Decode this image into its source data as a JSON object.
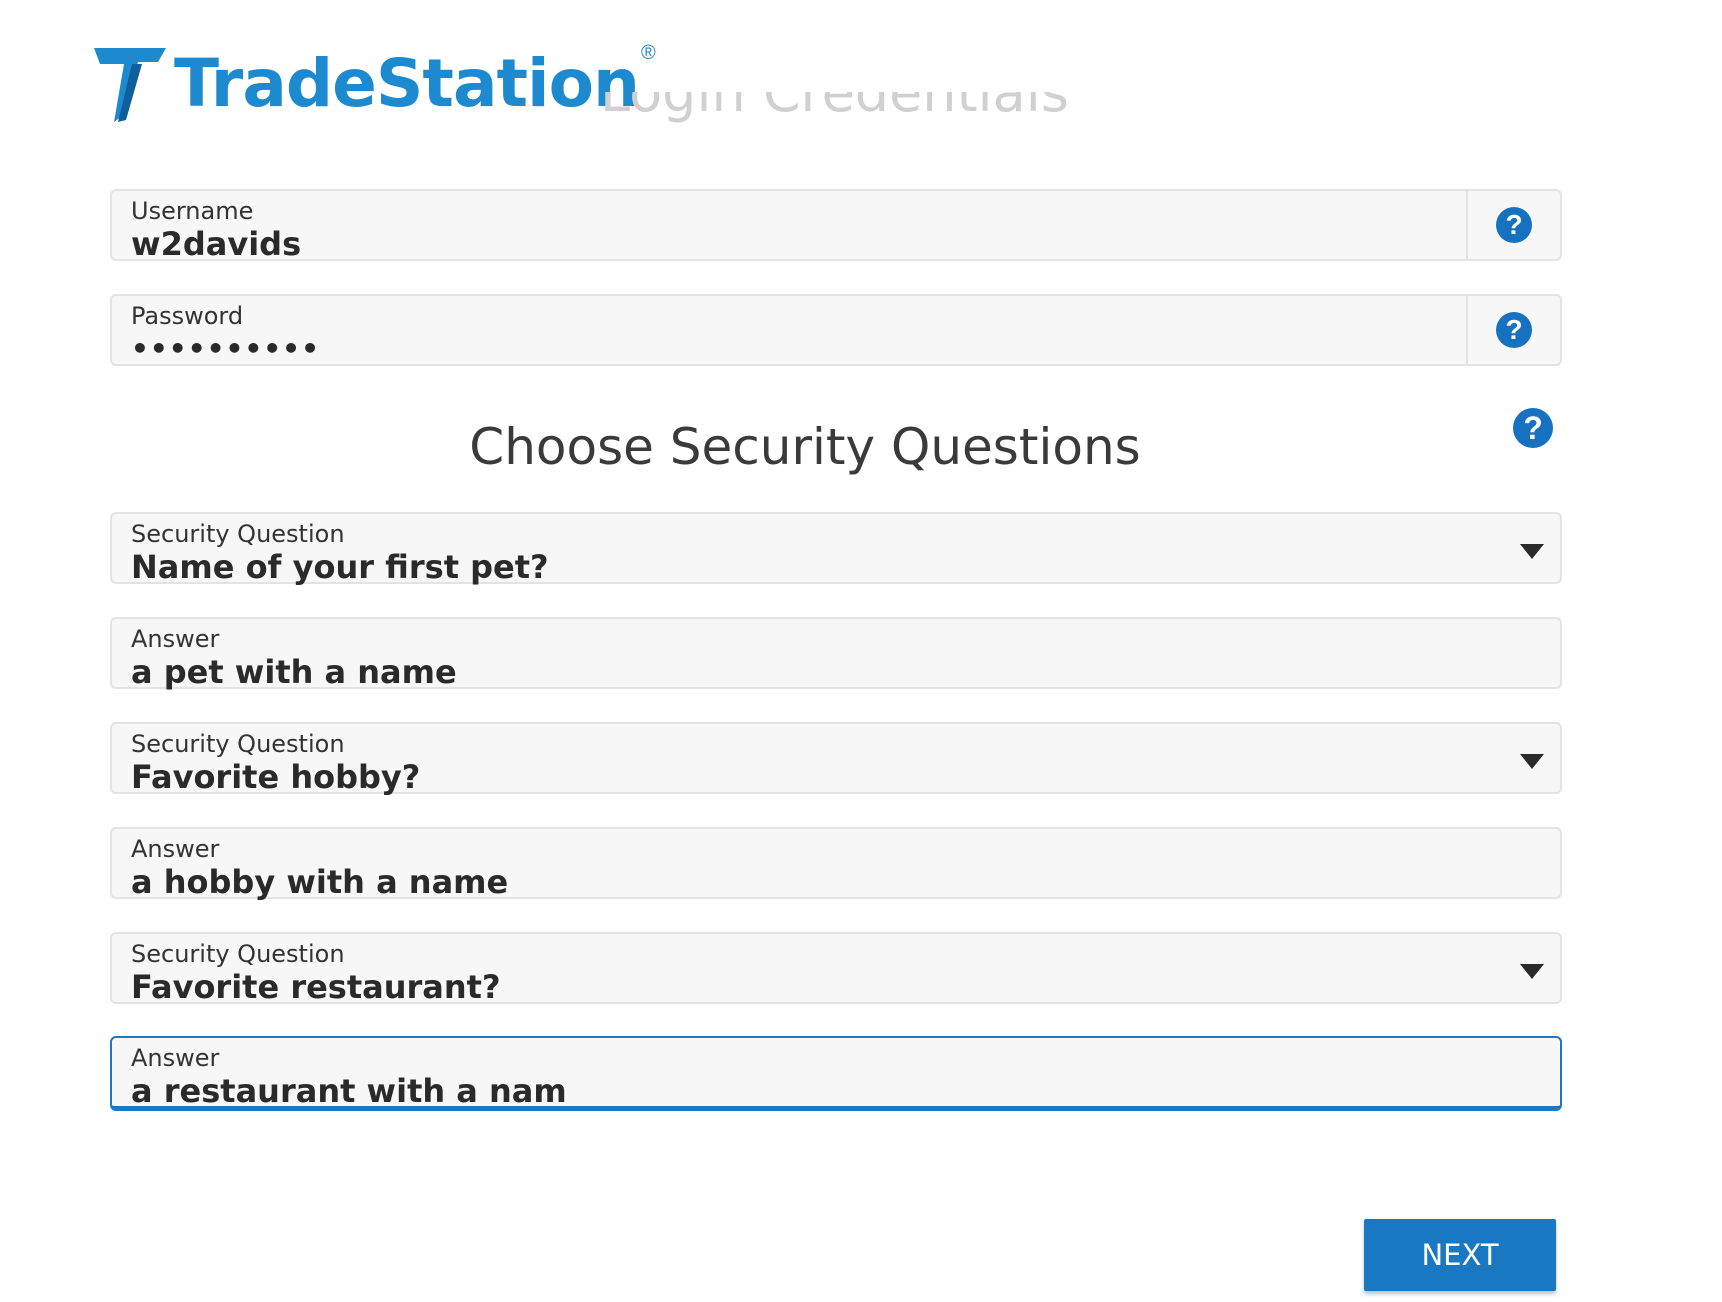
{
  "brand": {
    "name": "TradeStation",
    "registered": "®"
  },
  "background_heading": "Login Credentials",
  "credentials": {
    "username": {
      "label": "Username",
      "value": "w2davids"
    },
    "password": {
      "label": "Password",
      "value": "••••••••••"
    }
  },
  "help_glyph": "?",
  "security": {
    "title": "Choose Security Questions",
    "pairs": [
      {
        "question_label": "Security Question",
        "question": "Name of your first pet?",
        "answer_label": "Answer",
        "answer": "a pet with a name"
      },
      {
        "question_label": "Security Question",
        "question": "Favorite hobby?",
        "answer_label": "Answer",
        "answer": "a hobby with a name"
      },
      {
        "question_label": "Security Question",
        "question": "Favorite restaurant?",
        "answer_label": "Answer",
        "answer": "a restaurant with a nam"
      }
    ]
  },
  "next_label": "NEXT",
  "colors": {
    "brand_blue": "#1d8ad0",
    "button_blue": "#1a78c2",
    "focus_blue": "#1d77c2",
    "help_blue": "#1671c0"
  }
}
